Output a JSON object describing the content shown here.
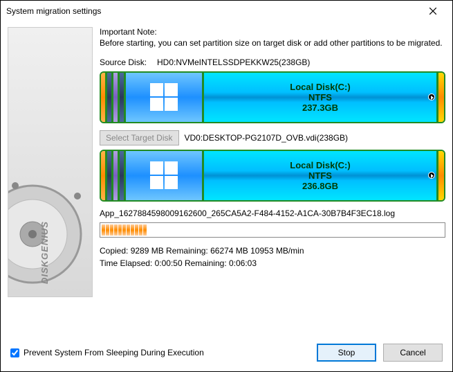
{
  "window": {
    "title": "System migration settings"
  },
  "note": {
    "title": "Important Note:",
    "body": "Before starting, you can set partition size on target disk or add other partitions to be migrated."
  },
  "source": {
    "label": "Source Disk:",
    "value": "HD0:NVMeINTELSSDPEKKW25(238GB)",
    "part_name": "Local Disk(C:)",
    "part_fs": "NTFS",
    "part_size": "237.3GB"
  },
  "target": {
    "button": "Select Target Disk",
    "value": "VD0:DESKTOP-PG2107D_OVB.vdi(238GB)",
    "part_name": "Local Disk(C:)",
    "part_fs": "NTFS",
    "part_size": "236.8GB"
  },
  "progress": {
    "filename": "App_1627884598009162600_265CA5A2-F484-4152-A1CA-30B7B4F3EC18.log",
    "line1": "Copied:  9289 MB   Remaining:   66274 MB   10953 MB/min",
    "line2": "Time Elapsed:  0:00:50   Remaining:  0:06:03"
  },
  "footer": {
    "checkbox": "Prevent System From Sleeping During Execution",
    "stop": "Stop",
    "cancel": "Cancel"
  },
  "brand": "DISKGENIUS"
}
